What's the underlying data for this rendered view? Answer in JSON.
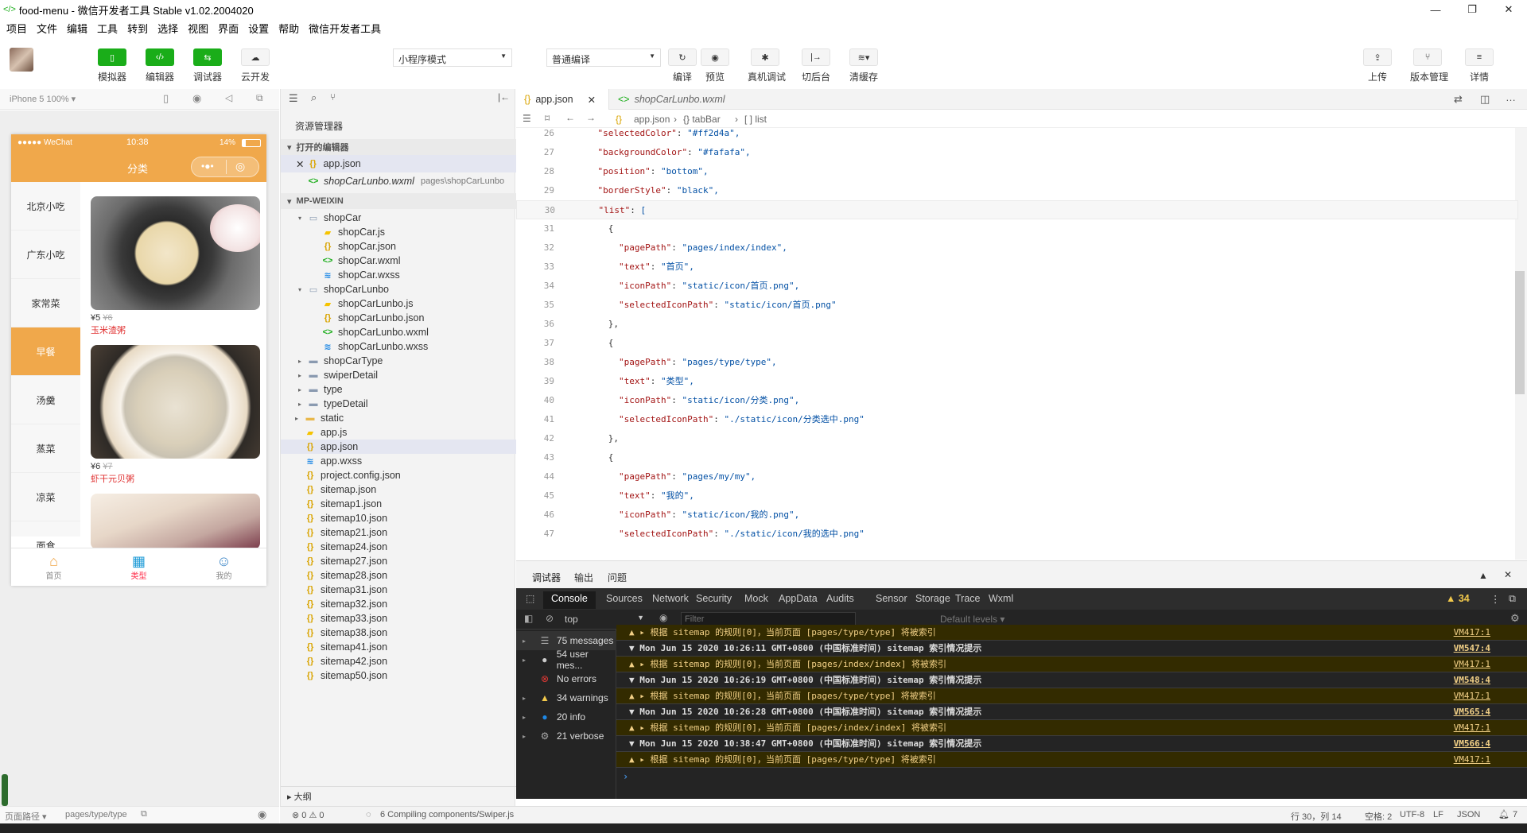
{
  "window": {
    "title": "food-menu - 微信开发者工具 Stable v1.02.2004020"
  },
  "menu": [
    "项目",
    "文件",
    "编辑",
    "工具",
    "转到",
    "选择",
    "视图",
    "界面",
    "设置",
    "帮助",
    "微信开发者工具"
  ],
  "toolbar": {
    "simulator": "模拟器",
    "editor": "编辑器",
    "debugger": "调试器",
    "cloud": "云开发",
    "mode": "小程序模式",
    "compile_mode": "普通编译",
    "compile": "编译",
    "preview": "预览",
    "remote_debug": "真机调试",
    "background": "切后台",
    "clear_cache": "清缓存",
    "upload": "上传",
    "version": "版本管理",
    "details": "详情"
  },
  "simulator": {
    "device": "iPhone 5 100% ▾",
    "status": {
      "carrier": "●●●●● WeChat",
      "time": "10:38",
      "battery": "14%"
    },
    "nav_title": "分类",
    "categories": [
      "北京小吃",
      "广东小吃",
      "家常菜",
      "早餐",
      "汤羹",
      "蒸菜",
      "凉菜",
      "面食"
    ],
    "selected_category": "早餐",
    "foods": [
      {
        "price": "¥5",
        "old": "¥6",
        "name": "玉米渣粥"
      },
      {
        "price": "¥6",
        "old": "¥7",
        "name": "虾干元贝粥"
      }
    ],
    "tabs": [
      "首页",
      "类型",
      "我的"
    ],
    "page_path_label": "页面路径 ▾",
    "page_path": "pages/type/type"
  },
  "explorer": {
    "title": "资源管理器",
    "open_editors": "打开的编辑器",
    "open_files": [
      {
        "name": "app.json",
        "path": ""
      },
      {
        "name": "shopCarLunbo.wxml",
        "path": "pages\\shopCarLunbo"
      }
    ],
    "project": "MP-WEIXIN",
    "tree": [
      {
        "name": "shopCar",
        "type": "folder-open",
        "depth": 2
      },
      {
        "name": "shopCar.js",
        "type": "js",
        "depth": 3
      },
      {
        "name": "shopCar.json",
        "type": "json",
        "depth": 3
      },
      {
        "name": "shopCar.wxml",
        "type": "wxml",
        "depth": 3
      },
      {
        "name": "shopCar.wxss",
        "type": "wxss",
        "depth": 3
      },
      {
        "name": "shopCarLunbo",
        "type": "folder-open",
        "depth": 2
      },
      {
        "name": "shopCarLunbo.js",
        "type": "js",
        "depth": 3
      },
      {
        "name": "shopCarLunbo.json",
        "type": "json",
        "depth": 3
      },
      {
        "name": "shopCarLunbo.wxml",
        "type": "wxml",
        "depth": 3
      },
      {
        "name": "shopCarLunbo.wxss",
        "type": "wxss",
        "depth": 3
      },
      {
        "name": "shopCarType",
        "type": "folder",
        "depth": 2
      },
      {
        "name": "swiperDetail",
        "type": "folder",
        "depth": 2
      },
      {
        "name": "type",
        "type": "folder",
        "depth": 2
      },
      {
        "name": "typeDetail",
        "type": "folder",
        "depth": 2
      },
      {
        "name": "static",
        "type": "folder-y",
        "depth": 1
      },
      {
        "name": "app.js",
        "type": "js",
        "depth": 1
      },
      {
        "name": "app.json",
        "type": "json",
        "depth": 1,
        "selected": true
      },
      {
        "name": "app.wxss",
        "type": "wxss",
        "depth": 1
      },
      {
        "name": "project.config.json",
        "type": "json",
        "depth": 1
      },
      {
        "name": "sitemap.json",
        "type": "json",
        "depth": 1
      },
      {
        "name": "sitemap1.json",
        "type": "json",
        "depth": 1
      },
      {
        "name": "sitemap10.json",
        "type": "json",
        "depth": 1
      },
      {
        "name": "sitemap21.json",
        "type": "json",
        "depth": 1
      },
      {
        "name": "sitemap24.json",
        "type": "json",
        "depth": 1
      },
      {
        "name": "sitemap27.json",
        "type": "json",
        "depth": 1
      },
      {
        "name": "sitemap28.json",
        "type": "json",
        "depth": 1
      },
      {
        "name": "sitemap31.json",
        "type": "json",
        "depth": 1
      },
      {
        "name": "sitemap32.json",
        "type": "json",
        "depth": 1
      },
      {
        "name": "sitemap33.json",
        "type": "json",
        "depth": 1
      },
      {
        "name": "sitemap38.json",
        "type": "json",
        "depth": 1
      },
      {
        "name": "sitemap41.json",
        "type": "json",
        "depth": 1
      },
      {
        "name": "sitemap42.json",
        "type": "json",
        "depth": 1
      },
      {
        "name": "sitemap50.json",
        "type": "json",
        "depth": 1
      }
    ],
    "outline": "大纲"
  },
  "editor": {
    "tabs": [
      {
        "name": "app.json",
        "active": true
      },
      {
        "name": "shopCarLunbo.wxml",
        "active": false
      }
    ],
    "breadcrumb": [
      "app.json",
      "{} tabBar",
      "[ ] list"
    ],
    "lines": [
      {
        "n": 26,
        "indent": 2,
        "key": "\"selectedColor\"",
        "val": "\"#ff2d4a\","
      },
      {
        "n": 27,
        "indent": 2,
        "key": "\"backgroundColor\"",
        "val": "\"#fafafa\","
      },
      {
        "n": 28,
        "indent": 2,
        "key": "\"position\"",
        "val": "\"bottom\","
      },
      {
        "n": 29,
        "indent": 2,
        "key": "\"borderStyle\"",
        "val": "\"black\","
      },
      {
        "n": 30,
        "indent": 2,
        "key": "\"list\"",
        "val": "[",
        "current": true
      },
      {
        "n": 31,
        "indent": 3,
        "key": "",
        "val": "{"
      },
      {
        "n": 32,
        "indent": 4,
        "key": "\"pagePath\"",
        "val": "\"pages/index/index\","
      },
      {
        "n": 33,
        "indent": 4,
        "key": "\"text\"",
        "val": "\"首页\","
      },
      {
        "n": 34,
        "indent": 4,
        "key": "\"iconPath\"",
        "val": "\"static/icon/首页.png\","
      },
      {
        "n": 35,
        "indent": 4,
        "key": "\"selectedIconPath\"",
        "val": "\"static/icon/首页.png\""
      },
      {
        "n": 36,
        "indent": 3,
        "key": "",
        "val": "},"
      },
      {
        "n": 37,
        "indent": 3,
        "key": "",
        "val": "{"
      },
      {
        "n": 38,
        "indent": 4,
        "key": "\"pagePath\"",
        "val": "\"pages/type/type\","
      },
      {
        "n": 39,
        "indent": 4,
        "key": "\"text\"",
        "val": "\"类型\","
      },
      {
        "n": 40,
        "indent": 4,
        "key": "\"iconPath\"",
        "val": "\"static/icon/分类.png\","
      },
      {
        "n": 41,
        "indent": 4,
        "key": "\"selectedIconPath\"",
        "val": "\"./static/icon/分类选中.png\""
      },
      {
        "n": 42,
        "indent": 3,
        "key": "",
        "val": "},"
      },
      {
        "n": 43,
        "indent": 3,
        "key": "",
        "val": "{"
      },
      {
        "n": 44,
        "indent": 4,
        "key": "\"pagePath\"",
        "val": "\"pages/my/my\","
      },
      {
        "n": 45,
        "indent": 4,
        "key": "\"text\"",
        "val": "\"我的\","
      },
      {
        "n": 46,
        "indent": 4,
        "key": "\"iconPath\"",
        "val": "\"static/icon/我的.png\","
      },
      {
        "n": 47,
        "indent": 4,
        "key": "\"selectedIconPath\"",
        "val": "\"./static/icon/我的选中.png\""
      }
    ]
  },
  "devtools": {
    "header_tabs": [
      "调试器",
      "输出",
      "问题"
    ],
    "tabs": [
      "Console",
      "Sources",
      "Network",
      "Security",
      "Mock",
      "AppData",
      "Audits",
      "Sensor",
      "Storage",
      "Trace",
      "Wxml"
    ],
    "warn_count": "34",
    "context": "top",
    "filter_placeholder": "Filter",
    "levels": "Default levels ▾",
    "sidebar": [
      {
        "label": "75 messages",
        "icon": "list"
      },
      {
        "label": "54 user mes...",
        "icon": "user"
      },
      {
        "label": "No errors",
        "icon": "error"
      },
      {
        "label": "34 warnings",
        "icon": "warn"
      },
      {
        "label": "20 info",
        "icon": "info"
      },
      {
        "label": "21 verbose",
        "icon": "gear"
      }
    ],
    "logs": [
      {
        "type": "warn",
        "text": "▲ ▸ 根据 sitemap 的规则[0]，当前页面 [pages/type/type] 将被索引",
        "src": "VM417:1"
      },
      {
        "type": "grp",
        "text": "▼ Mon Jun 15 2020 10:26:11 GMT+0800 (中国标准时间) sitemap 索引情况提示",
        "src": "VM547:4"
      },
      {
        "type": "warn",
        "text": "▲ ▸ 根据 sitemap 的规则[0]，当前页面 [pages/index/index] 将被索引",
        "src": "VM417:1"
      },
      {
        "type": "grp",
        "text": "▼ Mon Jun 15 2020 10:26:19 GMT+0800 (中国标准时间) sitemap 索引情况提示",
        "src": "VM548:4"
      },
      {
        "type": "warn",
        "text": "▲ ▸ 根据 sitemap 的规则[0]，当前页面 [pages/type/type] 将被索引",
        "src": "VM417:1"
      },
      {
        "type": "grp",
        "text": "▼ Mon Jun 15 2020 10:26:28 GMT+0800 (中国标准时间) sitemap 索引情况提示",
        "src": "VM565:4"
      },
      {
        "type": "warn",
        "text": "▲ ▸ 根据 sitemap 的规则[0]，当前页面 [pages/index/index] 将被索引",
        "src": "VM417:1"
      },
      {
        "type": "grp",
        "text": "▼ Mon Jun 15 2020 10:38:47 GMT+0800 (中国标准时间) sitemap 索引情况提示",
        "src": "VM566:4"
      },
      {
        "type": "warn",
        "text": "▲ ▸ 根据 sitemap 的规则[0]，当前页面 [pages/type/type] 将被索引",
        "src": "VM417:1"
      }
    ]
  },
  "status": {
    "errors": "⊗ 0 ⚠ 0",
    "compiling": "6 Compiling components/Swiper.js",
    "position": "行 30，列 14",
    "spaces": "空格: 2",
    "encoding": "UTF-8",
    "eol": "LF",
    "lang": "JSON",
    "bell": "7"
  },
  "colors": {
    "accent": "#f0a84b",
    "green": "#1aad19",
    "price_red": "#e03030"
  }
}
